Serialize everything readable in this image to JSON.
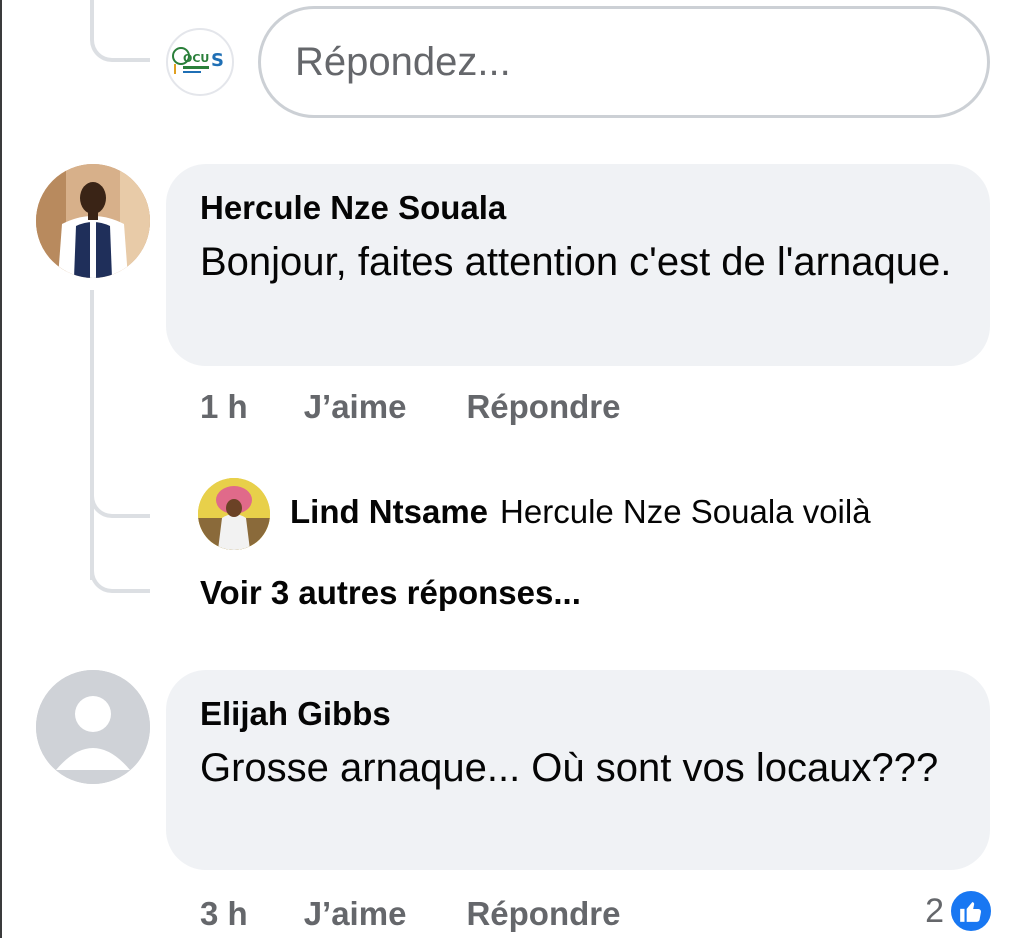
{
  "reply_box": {
    "placeholder": "Répondez...",
    "avatar_logo": "FOCUS"
  },
  "comments": [
    {
      "author": "Hercule Nze Souala",
      "text": "Bonjour, faites attention c'est de l'arnaque.",
      "time": "1 h",
      "like_label": "J’aime",
      "reply_label": "Répondre"
    },
    {
      "author": "Elijah Gibbs",
      "text": "Grosse arnaque... Où sont vos locaux???",
      "time": "3 h",
      "like_label": "J’aime",
      "reply_label": "Répondre",
      "reaction_count": "2"
    }
  ],
  "nested_reply": {
    "author": "Lind Ntsame",
    "text": "Hercule Nze Souala voilà"
  },
  "more_replies_label": "Voir 3 autres réponses...",
  "colors": {
    "bubble": "#f0f2f5",
    "meta_text": "#65676b",
    "like_blue": "#1877f2",
    "thread_line": "#dcdfe3"
  },
  "icons": {
    "reaction": "thumbs-up-icon",
    "default_avatar": "user-silhouette-icon"
  }
}
